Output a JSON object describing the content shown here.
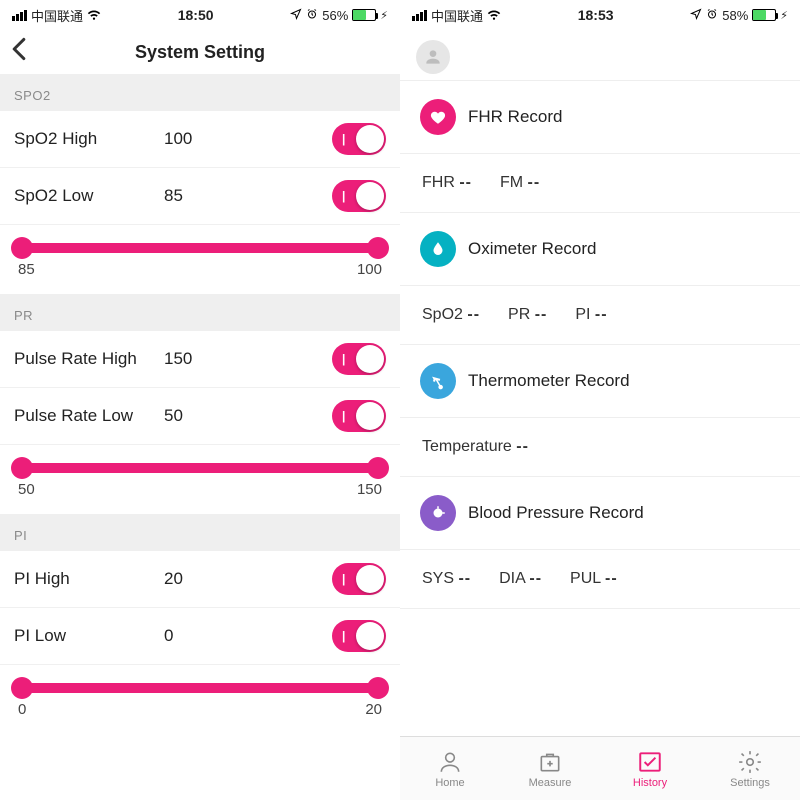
{
  "left": {
    "status": {
      "carrier": "中国联通",
      "time": "18:50",
      "battery_pct": "56%",
      "battery_fill": 56
    },
    "title": "System Setting",
    "sections": [
      {
        "header": "SPO2",
        "rows": [
          {
            "label": "SpO2 High",
            "value": "100"
          },
          {
            "label": "SpO2 Low",
            "value": "85"
          }
        ],
        "slider": {
          "min_label": "85",
          "max_label": "100"
        }
      },
      {
        "header": "PR",
        "rows": [
          {
            "label": "Pulse Rate High",
            "value": "150"
          },
          {
            "label": "Pulse Rate Low",
            "value": "50"
          }
        ],
        "slider": {
          "min_label": "50",
          "max_label": "150"
        }
      },
      {
        "header": "PI",
        "rows": [
          {
            "label": "PI High",
            "value": "20"
          },
          {
            "label": "PI Low",
            "value": "0"
          }
        ],
        "slider": {
          "min_label": "0",
          "max_label": "20"
        }
      }
    ]
  },
  "right": {
    "status": {
      "carrier": "中国联通",
      "time": "18:53",
      "battery_pct": "58%",
      "battery_fill": 58
    },
    "records": [
      {
        "title": "FHR Record",
        "color": "c-pink",
        "fields": [
          {
            "k": "FHR",
            "v": "--"
          },
          {
            "k": "FM",
            "v": "--"
          }
        ]
      },
      {
        "title": "Oximeter Record",
        "color": "c-teal",
        "fields": [
          {
            "k": "SpO2",
            "v": "--"
          },
          {
            "k": "PR",
            "v": "--"
          },
          {
            "k": "PI",
            "v": "--"
          }
        ]
      },
      {
        "title": "Thermometer Record",
        "color": "c-blue",
        "fields": [
          {
            "k": "Temperature",
            "v": "--"
          }
        ]
      },
      {
        "title": "Blood Pressure Record",
        "color": "c-purple",
        "fields": [
          {
            "k": "SYS",
            "v": "--"
          },
          {
            "k": "DIA",
            "v": "--"
          },
          {
            "k": "PUL",
            "v": "--"
          }
        ]
      }
    ],
    "tabs": [
      {
        "label": "Home"
      },
      {
        "label": "Measure"
      },
      {
        "label": "History"
      },
      {
        "label": "Settings"
      }
    ],
    "active_tab": 2
  }
}
